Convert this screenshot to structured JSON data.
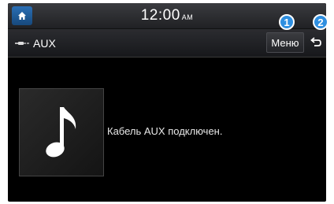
{
  "status_bar": {
    "time": "12:00",
    "ampm": "AM"
  },
  "title_bar": {
    "source": "AUX",
    "menu_label": "Меню"
  },
  "main": {
    "status_message": "Кабель AUX подключен."
  },
  "callouts": [
    "1",
    "2"
  ],
  "icons": {
    "home": "home-icon",
    "aux": "aux-cable-icon",
    "back": "back-arrow-icon",
    "art": "music-note-icon"
  },
  "colors": {
    "accent": "#1f5f9e",
    "callout": "#2f8fe0",
    "background": "#000000"
  }
}
